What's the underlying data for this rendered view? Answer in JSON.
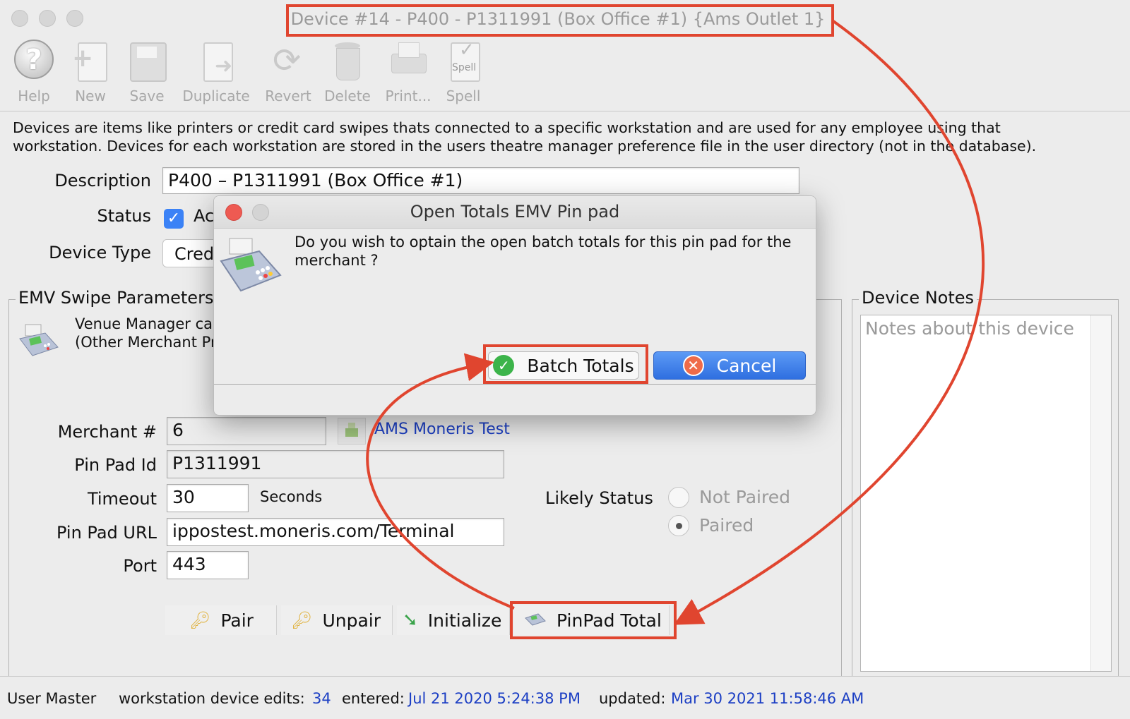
{
  "window": {
    "title": "Device #14 - P400 - P1311991 (Box Office #1) {Ams Outlet 1}"
  },
  "toolbar": {
    "help": "Help",
    "new": "New",
    "save": "Save",
    "duplicate": "Duplicate",
    "revert": "Revert",
    "delete": "Delete",
    "print": "Print...",
    "spell": "Spell",
    "spell_icon_text": "Spell"
  },
  "help_text": {
    "line1": "Devices are items like printers or credit card swipes thats connected to a specific workstation and are used for any employee using that",
    "line2": "workstation.  Devices for each workstation are stored in the users theatre manager preference file in the user directory (not in the database)."
  },
  "form": {
    "description_label": "Description",
    "description_value": "P400 – P1311991 (Box Office #1)",
    "status_label": "Status",
    "status_checkbox_text": "Ac",
    "device_type_label": "Device Type",
    "device_type_value": "Cred"
  },
  "emv": {
    "group_title": "EMV Swipe Parameters",
    "info_line1": "Venue Manager ca",
    "info_line2": "(Other Merchant Pr",
    "merchant_label": "Merchant #",
    "merchant_value": "6",
    "merchant_link": "AMS Moneris Test",
    "pinpad_id_label": "Pin Pad Id",
    "pinpad_id_value": "P1311991",
    "timeout_label": "Timeout",
    "timeout_value": "30",
    "timeout_unit": "Seconds",
    "url_label": "Pin Pad URL",
    "url_value": "ippostest.moneris.com/Terminal",
    "port_label": "Port",
    "port_value": "443",
    "likely_status_label": "Likely Status",
    "not_paired": "Not Paired",
    "paired": "Paired",
    "selected_status": "Paired",
    "buttons": {
      "pair": "Pair",
      "unpair": "Unpair",
      "initialize": "Initialize",
      "pinpad_total": "PinPad Total"
    }
  },
  "notes": {
    "group_title": "Device Notes",
    "placeholder": "Notes about this device"
  },
  "status_bar": {
    "user": "User Master",
    "edits_label": "workstation device edits:",
    "edits_value": "34",
    "entered_label": "entered:",
    "entered_value": "Jul 21 2020 5:24:38 PM",
    "updated_label": "updated:",
    "updated_value": "Mar 30 2021 11:58:46 AM"
  },
  "dialog": {
    "title": "Open Totals EMV Pin pad",
    "message_line1": "Do you wish to optain the open batch totals for this pin pad for the",
    "message_line2": "merchant ?",
    "ok_label": "Batch Totals",
    "cancel_label": "Cancel"
  },
  "colors": {
    "annotation": "#e0452f",
    "link": "#1c3fc4",
    "cancel_button": "#3a7ae8"
  }
}
